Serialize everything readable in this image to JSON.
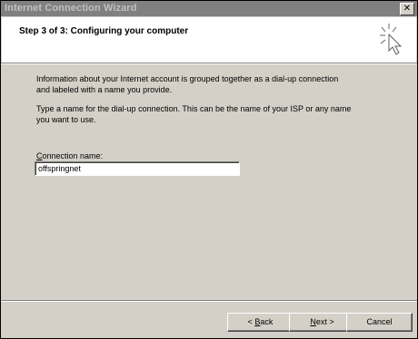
{
  "window": {
    "title": "Internet Connection Wizard",
    "close_glyph": "✕"
  },
  "header": {
    "step_title": "Step 3 of 3: Configuring your computer",
    "icon": "wizard-arrow-icon"
  },
  "body": {
    "info_line1": "Information about your Internet account is grouped together as a dial-up connection",
    "info_line2": "and labeled with a name you provide.",
    "info_line3": "Type a name for the dial-up connection. This can be the name of your ISP or any name",
    "info_line4": "you want to use.",
    "connection_label_underlined": "C",
    "connection_label_rest": "onnection name:",
    "connection_name_value": "offspringnet"
  },
  "buttons": {
    "back_prefix": "< ",
    "back_underlined": "B",
    "back_rest": "ack",
    "next_underlined": "N",
    "next_rest": "ext >",
    "cancel": "Cancel"
  }
}
